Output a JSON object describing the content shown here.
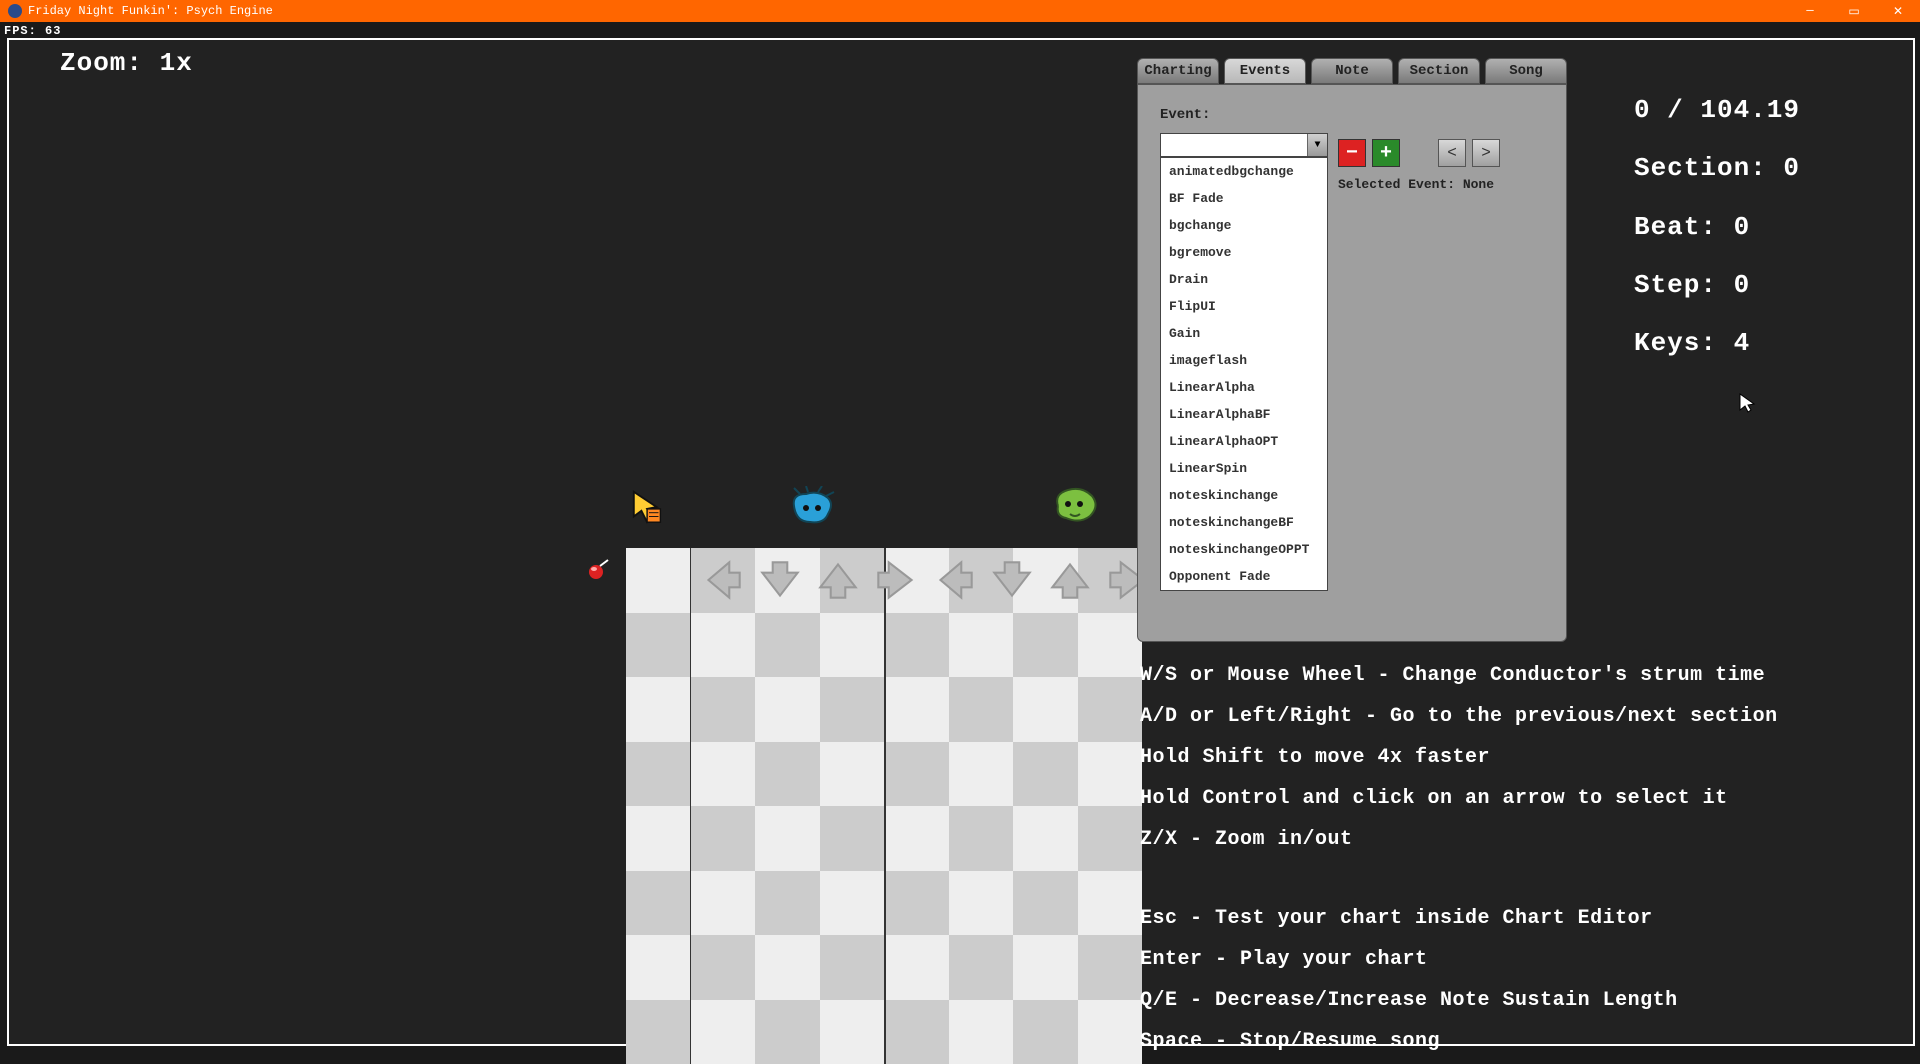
{
  "window": {
    "title": "Friday Night Funkin': Psych Engine",
    "fps": "FPS: 63"
  },
  "zoom": "Zoom: 1x",
  "stats": {
    "time": "0 / 104.19",
    "section": "Section: 0",
    "beat": "Beat: 0",
    "step": "Step: 0",
    "keys": "Keys: 4"
  },
  "tabs": {
    "charting": "Charting",
    "events": "Events",
    "note": "Note",
    "section": "Section",
    "song": "Song",
    "active": "Events"
  },
  "events_panel": {
    "label": "Event:",
    "selected": "",
    "selected_event_text": "Selected Event: None",
    "options": [
      "animatedbgchange",
      "BF Fade",
      "bgchange",
      "bgremove",
      "Drain",
      "FlipUI",
      "Gain",
      "imageflash",
      "LinearAlpha",
      "LinearAlphaBF",
      "LinearAlphaOPT",
      "LinearSpin",
      "noteskinchange",
      "noteskinchangeBF",
      "noteskinchangeOPPT",
      "Opponent Fade"
    ]
  },
  "help": {
    "l1": "W/S or Mouse Wheel - Change Conductor's strum time",
    "l2": "A/D or Left/Right - Go to the previous/next section",
    "l3": "Hold Shift to move 4x faster",
    "l4": "Hold Control and click on an arrow to select it",
    "l5": "Z/X - Zoom in/out",
    "l6": "Esc - Test your chart inside Chart Editor",
    "l7": "Enter - Play your chart",
    "l8": "Q/E - Decrease/Increase Note Sustain Length",
    "l9": "Space - Stop/Resume song"
  }
}
